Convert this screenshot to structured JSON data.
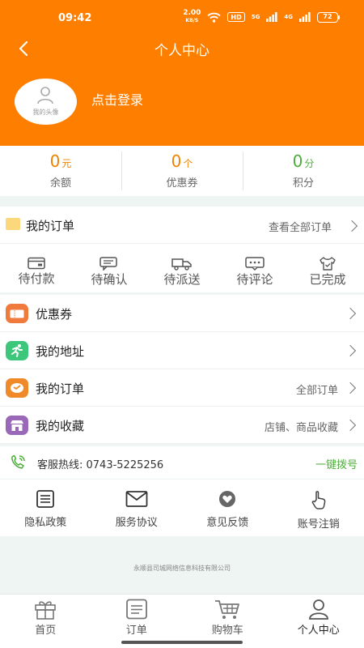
{
  "status_bar": {
    "time": "09:42",
    "speed_value": "2.00",
    "speed_unit": "KB/S",
    "hd_label": "HD",
    "signal1_label": "5G",
    "signal2_label": "4G",
    "battery": "72"
  },
  "header": {
    "title": "个人中心",
    "avatar_caption": "我的头像",
    "login_label": "点击登录",
    "background": "#fe7f00"
  },
  "stats": [
    {
      "value": "0",
      "unit": "元",
      "label": "余额"
    },
    {
      "value": "0",
      "unit": "个",
      "label": "优惠券"
    },
    {
      "value": "0",
      "unit": "分",
      "label": "积分"
    }
  ],
  "orders": {
    "title": "我的订单",
    "more": "查看全部订单",
    "statuses": [
      {
        "label": "待付款",
        "icon": "wallet-icon"
      },
      {
        "label": "待确认",
        "icon": "chat-icon"
      },
      {
        "label": "待派送",
        "icon": "truck-icon"
      },
      {
        "label": "待评论",
        "icon": "comment-icon"
      },
      {
        "label": "已完成",
        "icon": "shirt-icon"
      }
    ]
  },
  "menu": [
    {
      "label": "优惠券",
      "extra": "",
      "icon": "coupon-icon",
      "color": "#f07a3c"
    },
    {
      "label": "我的地址",
      "extra": "",
      "icon": "runner-icon",
      "color": "#3cc77a"
    },
    {
      "label": "我的订单",
      "extra": "全部订单",
      "icon": "order-icon",
      "color": "#f08a28"
    },
    {
      "label": "我的收藏",
      "extra": "店铺、商品收藏",
      "icon": "store-icon",
      "color": "#9a68b8"
    }
  ],
  "hotline": {
    "label": "客服热线: 0743-5225256",
    "action": "一键拨号"
  },
  "links": [
    {
      "label": "隐私政策",
      "icon": "document-icon"
    },
    {
      "label": "服务协议",
      "icon": "mail-icon"
    },
    {
      "label": "意见反馈",
      "icon": "heart-icon"
    },
    {
      "label": "账号注销",
      "icon": "hand-pointer-icon"
    }
  ],
  "footer": {
    "company": "永顺县司城网络信息科技有限公司"
  },
  "tabbar": [
    {
      "label": "首页",
      "icon": "gift-icon"
    },
    {
      "label": "订单",
      "icon": "list-icon"
    },
    {
      "label": "购物车",
      "icon": "cart-icon"
    },
    {
      "label": "个人中心",
      "icon": "user-icon",
      "active": true
    }
  ]
}
